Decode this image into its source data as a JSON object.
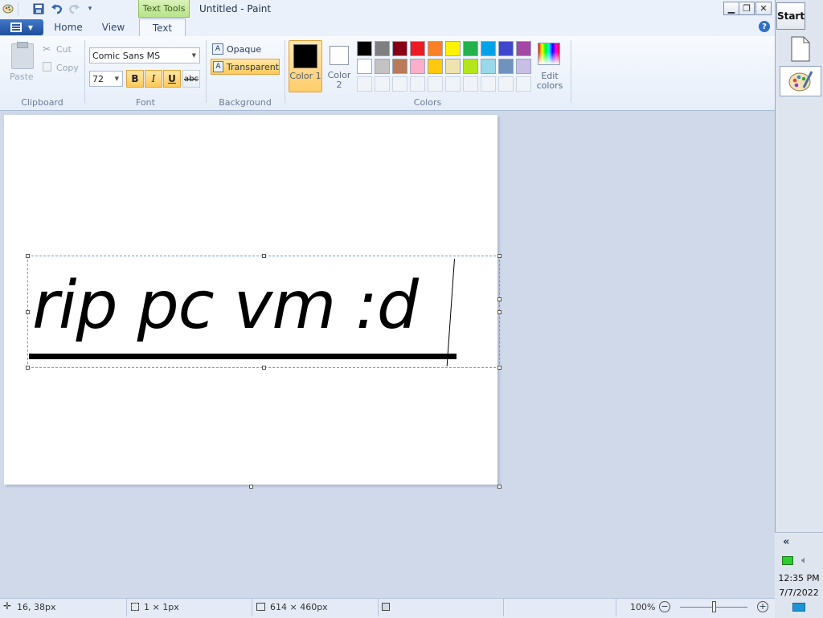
{
  "window": {
    "title": "Untitled - Paint",
    "contextual_tab": "Text Tools",
    "controls": {
      "minimize": "▁",
      "restore": "❐",
      "close": "✕"
    }
  },
  "tabs": [
    {
      "label": "Home"
    },
    {
      "label": "View"
    },
    {
      "label": "Text"
    }
  ],
  "ribbon": {
    "clipboard": {
      "group": "Clipboard",
      "paste": "Paste",
      "cut": "Cut",
      "copy": "Copy"
    },
    "font": {
      "group": "Font",
      "family": "Comic Sans MS",
      "size": "72",
      "bold": "B",
      "italic": "I",
      "underline": "U",
      "strikethrough": "abc"
    },
    "background": {
      "group": "Background",
      "opaque": "Opaque",
      "transparent": "Transparent"
    },
    "colors": {
      "group": "Colors",
      "color1_label": "Color 1",
      "color2_label": "Color 2",
      "color1": "#000000",
      "color2": "#ffffff",
      "edit_label": "Edit colors",
      "palette_row1": [
        "#000000",
        "#7f7f7f",
        "#880015",
        "#ed1c24",
        "#ff7f27",
        "#fff200",
        "#22b14c",
        "#00a2e8",
        "#3f48cc",
        "#a349a4"
      ],
      "palette_row2": [
        "#ffffff",
        "#c3c3c3",
        "#b97a57",
        "#ffaec9",
        "#ffc90e",
        "#efe4b0",
        "#b5e61d",
        "#99d9ea",
        "#7092be",
        "#c8bfe7"
      ]
    }
  },
  "canvas": {
    "text": "rip pc vm :d"
  },
  "status": {
    "cursor_pos": "16, 38px",
    "selection_size": "1 × 1px",
    "image_size": "614 × 460px",
    "zoom": "100%"
  },
  "taskbar": {
    "start": "Start",
    "collapse": "«",
    "time": "12:35 PM",
    "date": "7/7/2022"
  }
}
